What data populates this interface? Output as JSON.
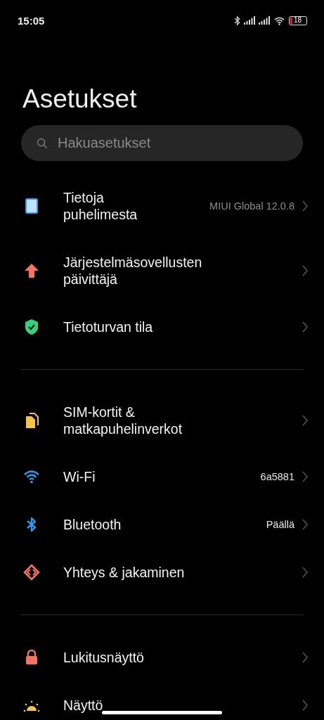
{
  "status_bar": {
    "time": "15:05",
    "battery": "18"
  },
  "title": "Asetukset",
  "search": {
    "placeholder": "Hakuasetukset"
  },
  "groups": [
    {
      "items": [
        {
          "kind": "phone",
          "label": "Tietoja puhelimesta",
          "value": "MIUI Global 12.0.8"
        },
        {
          "kind": "update",
          "label": "Järjestelmäsovellusten päivittäjä"
        },
        {
          "kind": "security",
          "label": "Tietoturvan tila"
        }
      ]
    },
    {
      "items": [
        {
          "kind": "sim",
          "label": "SIM-kortit & matkapuhelinverkot"
        },
        {
          "kind": "wifi",
          "label": "Wi-Fi",
          "value": "6a5881"
        },
        {
          "kind": "bluetooth",
          "label": "Bluetooth",
          "value": "Päällä"
        },
        {
          "kind": "sharing",
          "label": "Yhteys & jakaminen"
        }
      ]
    },
    {
      "items": [
        {
          "kind": "lock",
          "label": "Lukitusnäyttö"
        },
        {
          "kind": "display",
          "label": "Näyttö"
        }
      ]
    }
  ]
}
